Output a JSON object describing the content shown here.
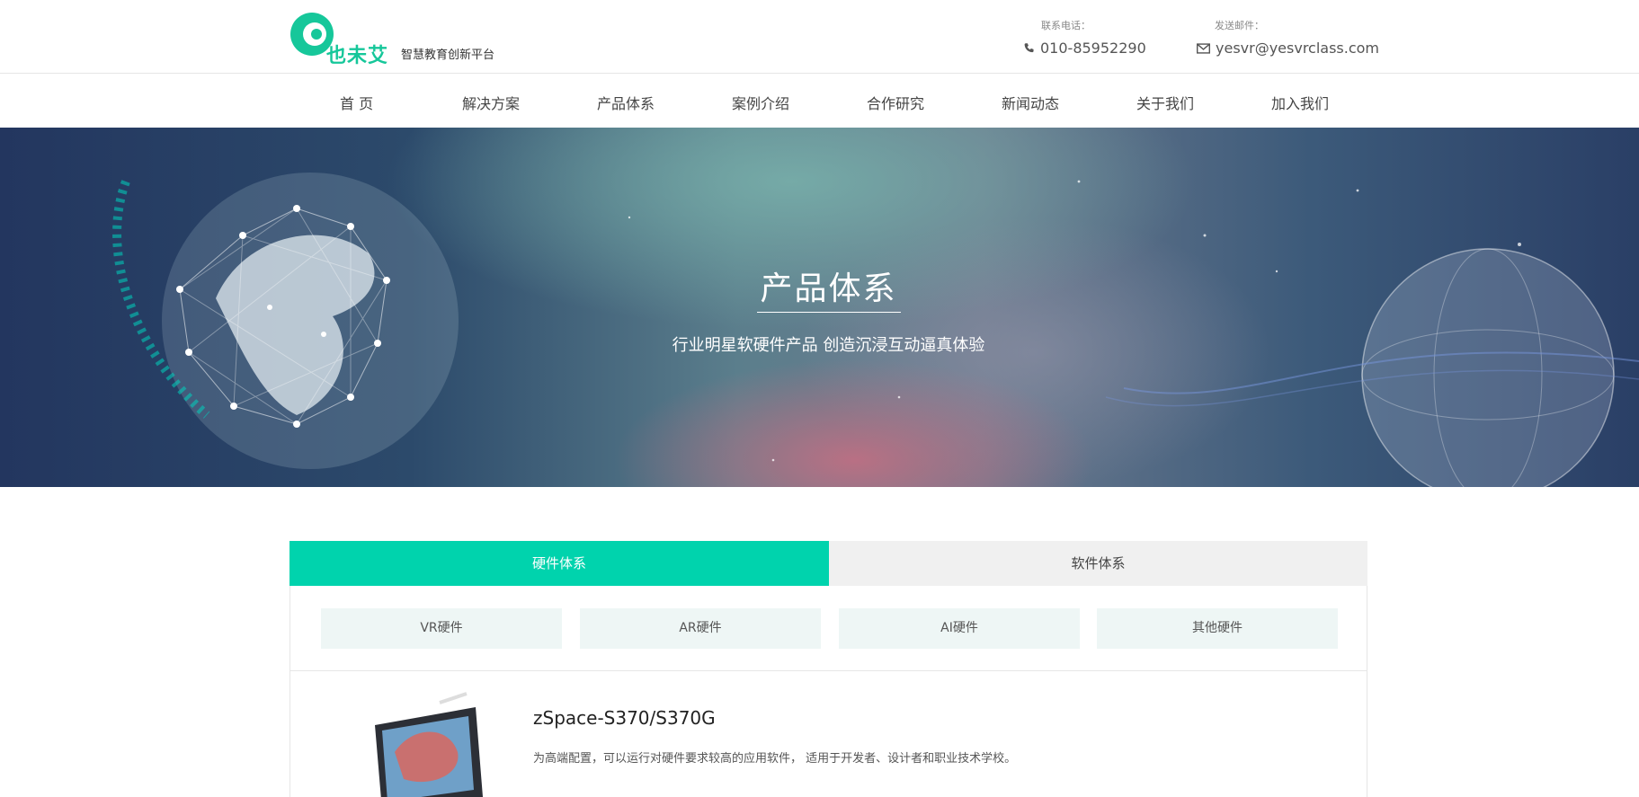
{
  "brand": {
    "logo_text": "也未艾",
    "slogan": "智慧教育创新平台",
    "accent_color": "#00d3ad"
  },
  "contact": {
    "phone_label": "联系电话：",
    "phone": "010-85952290",
    "mail_label": "发送邮件：",
    "mail": "yesvr@yesvrclass.com"
  },
  "nav": {
    "items": [
      "首 页",
      "解决方案",
      "产品体系",
      "案例介绍",
      "合作研究",
      "新闻动态",
      "关于我们",
      "加入我们"
    ]
  },
  "banner": {
    "title": "产品体系",
    "subtitle": "行业明星软硬件产品 创造沉浸互动逼真体验"
  },
  "tabs": {
    "hardware": "硬件体系",
    "software": "软件体系",
    "active": "hardware"
  },
  "subtabs": [
    "VR硬件",
    "AR硬件",
    "AI硬件",
    "其他硬件"
  ],
  "product": {
    "name": "zSpace-S370/S370G",
    "description": "为高端配置，可以运行对硬件要求较高的应用软件， 适用于开发者、设计者和职业技术学校。"
  }
}
